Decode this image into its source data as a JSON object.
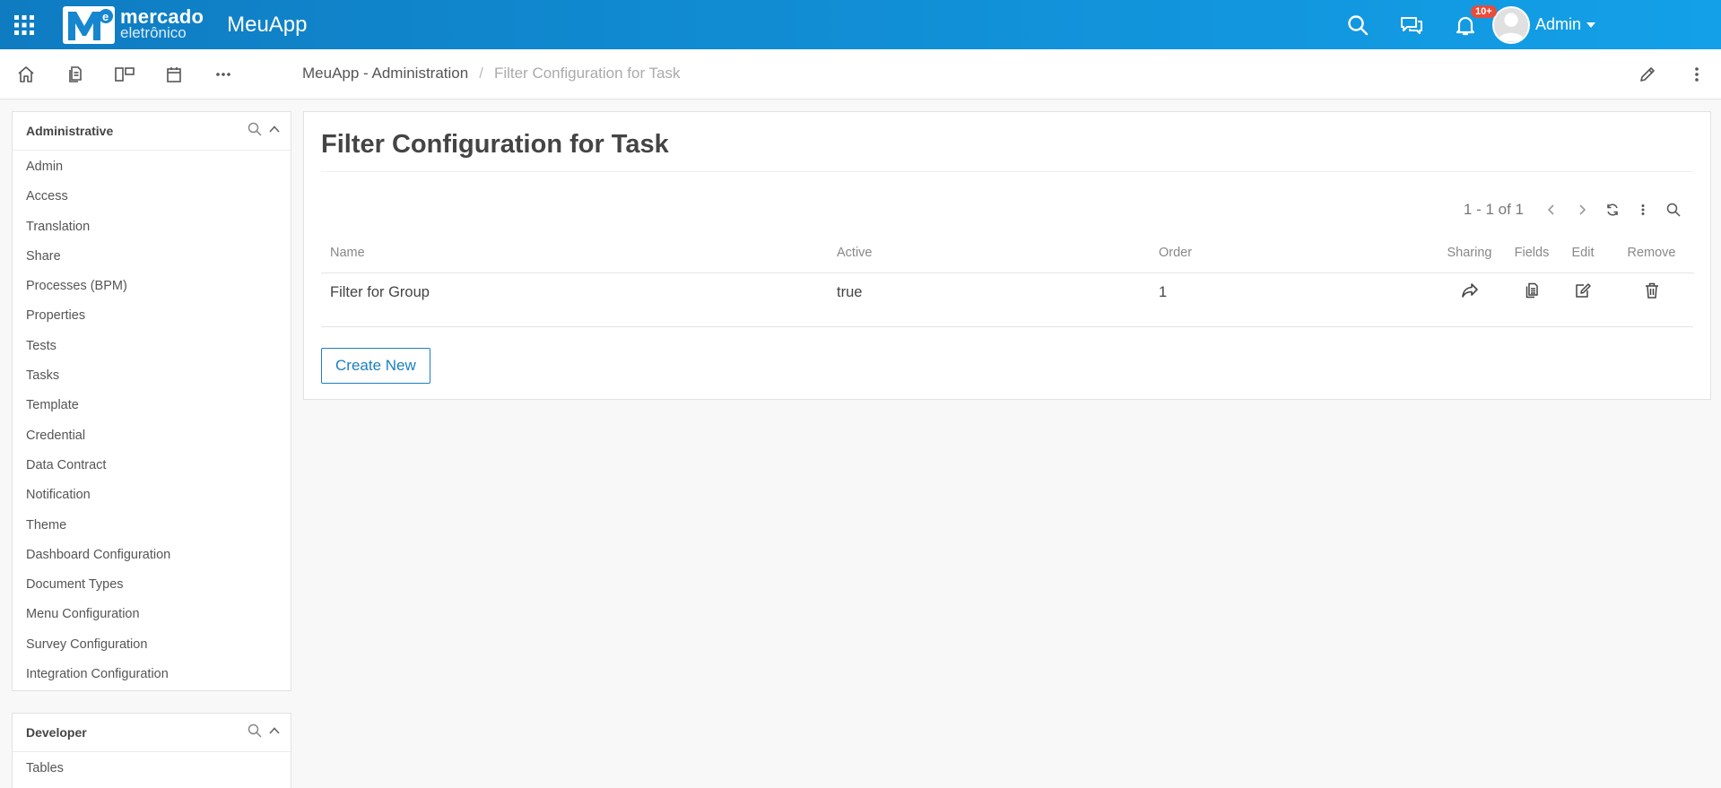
{
  "colors": {
    "topbar_start": "#0f7cc2",
    "topbar_end": "#13a0e8",
    "primary_button": "#1a7fc1",
    "badge": "#e74c3c"
  },
  "topbar": {
    "logo_line1": "mercado",
    "logo_line2": "eletrônico",
    "app_name": "MeuApp",
    "notifications_badge": "10+",
    "user_name": "Admin",
    "icons": [
      "apps-grid-icon",
      "search-icon",
      "chat-icon",
      "bell-icon",
      "avatar",
      "chevron-down-icon"
    ]
  },
  "toolbar": {
    "icons": [
      "home-icon",
      "documents-icon",
      "layout-icon",
      "calendar-icon",
      "more-horizontal-icon",
      "pencil-icon",
      "more-vertical-icon"
    ]
  },
  "breadcrumb": {
    "parent": "MeuApp - Administration",
    "separator": "/",
    "current": "Filter Configuration for Task"
  },
  "sidebar": {
    "administrative": {
      "title": "Administrative",
      "items": [
        {
          "label": "Admin"
        },
        {
          "label": "Access"
        },
        {
          "label": "Translation"
        },
        {
          "label": "Share"
        },
        {
          "label": "Processes (BPM)"
        },
        {
          "label": "Properties"
        },
        {
          "label": "Tests"
        },
        {
          "label": "Tasks"
        },
        {
          "label": "Template"
        },
        {
          "label": "Credential"
        },
        {
          "label": "Data Contract"
        },
        {
          "label": "Notification"
        },
        {
          "label": "Theme"
        },
        {
          "label": "Dashboard Configuration"
        },
        {
          "label": "Document Types"
        },
        {
          "label": "Menu Configuration"
        },
        {
          "label": "Survey Configuration"
        },
        {
          "label": "Integration Configuration"
        }
      ]
    },
    "developer": {
      "title": "Developer",
      "items": [
        {
          "label": "Tables"
        }
      ]
    }
  },
  "main": {
    "title": "Filter Configuration for Task",
    "pager": {
      "count": "1 - 1 of 1",
      "icons": [
        "chevron-left-icon",
        "chevron-right-icon",
        "refresh-icon",
        "more-vertical-icon",
        "search-icon"
      ]
    },
    "table": {
      "headers": {
        "name": "Name",
        "active": "Active",
        "order": "Order",
        "sharing": "Sharing",
        "fields": "Fields",
        "edit": "Edit",
        "remove": "Remove"
      },
      "rows": [
        {
          "name": "Filter for Group",
          "active": "true",
          "order": "1",
          "action_icons": [
            "share-icon",
            "fields-icon",
            "edit-icon",
            "trash-icon"
          ]
        }
      ]
    },
    "create_button": "Create New"
  }
}
